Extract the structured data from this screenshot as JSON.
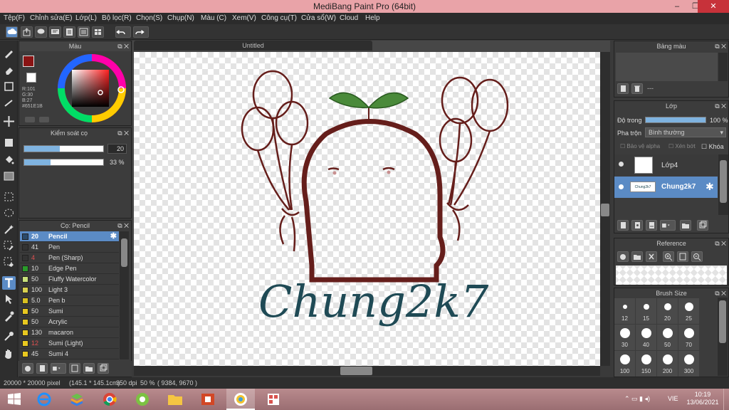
{
  "app": {
    "title": "MediBang Paint Pro (64bit)"
  },
  "window_buttons": {
    "minimize": "–",
    "maximize": "❐",
    "close": "✕"
  },
  "menu": [
    "Tệp(F)",
    "Chỉnh sửa(E)",
    "Lớp(L)",
    "Bộ lọc(R)",
    "Chọn(S)",
    "Chụp(N)",
    "Màu (C)",
    "Xem(V)",
    "Công cụ(T)",
    "Cửa sổ(W)",
    "Cloud",
    "Help"
  ],
  "color_panel": {
    "title": "Màu",
    "primary_color": "#651E1B",
    "r_label": "R:101",
    "g_label": "G:30",
    "b_label": "B:27",
    "hex_label": "#651E1B"
  },
  "brush_control": {
    "title": "Kiểm soát cọ",
    "size_value": "20",
    "size_fill": 0.45,
    "opacity_value": "33 %",
    "opacity_fill": 0.33
  },
  "brush_panel": {
    "title": "Cọ: Pencil",
    "items": [
      {
        "size": "20",
        "name": "Pencil",
        "color": "#2b4a6a",
        "selected": true
      },
      {
        "size": "41",
        "name": "Pen",
        "color": "#333"
      },
      {
        "size": "4",
        "name": "Pen (Sharp)",
        "color": "#333",
        "red": true
      },
      {
        "size": "10",
        "name": "Edge Pen",
        "color": "#2a9a2a"
      },
      {
        "size": "50",
        "name": "Fluffy Watercolor",
        "color": "#c8e07a"
      },
      {
        "size": "100",
        "name": "Light 3",
        "color": "#d8d050"
      },
      {
        "size": "5.0",
        "name": "Pen b",
        "color": "#d8c020"
      },
      {
        "size": "50",
        "name": "Sumi",
        "color": "#e8c820"
      },
      {
        "size": "50",
        "name": "Acrylic",
        "color": "#e8c820"
      },
      {
        "size": "130",
        "name": "macaron",
        "color": "#e8c820"
      },
      {
        "size": "12",
        "name": "Sumi (Light)",
        "color": "#e8c820",
        "red": true
      },
      {
        "size": "45",
        "name": "Sumi 4",
        "color": "#e8c820"
      }
    ]
  },
  "document": {
    "tab_title": "Untitled",
    "signature_text": "Chung2k7"
  },
  "palette_panel": {
    "title": "Bảng màu",
    "placeholder": "---"
  },
  "layer_panel": {
    "title": "Lớp",
    "opacity_label": "Độ trong",
    "opacity_value": "100 %",
    "blend_label": "Pha trộn",
    "blend_value": "Bình thường",
    "protect_alpha": "Bảo vệ alpha",
    "clipping": "Xén bớt",
    "lock": "Khóa",
    "layers": [
      {
        "name": "Lớp4",
        "selected": false
      },
      {
        "name": "Chung2k7",
        "thumb_text": "Chung2k7",
        "selected": true
      }
    ]
  },
  "reference_panel": {
    "title": "Reference"
  },
  "brush_size_panel": {
    "title": "Brush Size",
    "sizes": [
      "12",
      "15",
      "20",
      "25",
      "30",
      "40",
      "50",
      "70",
      "100",
      "150",
      "200",
      "300"
    ]
  },
  "status": {
    "canvas_size": "20000 * 20000 pixel",
    "physical_size": "(145.1 * 145.1cm)",
    "dpi": "350 dpi",
    "zoom": "50 %",
    "coords": "( 9384, 9670 )"
  },
  "taskbar": {
    "time": "10:19",
    "date": "13/06/2021",
    "lang": "VIE"
  },
  "colors": {
    "accent": "#5b8bc5",
    "drawing_brown": "#651E1B",
    "text_teal": "#1f4a55",
    "leaf_green": "#4a8a3a"
  }
}
